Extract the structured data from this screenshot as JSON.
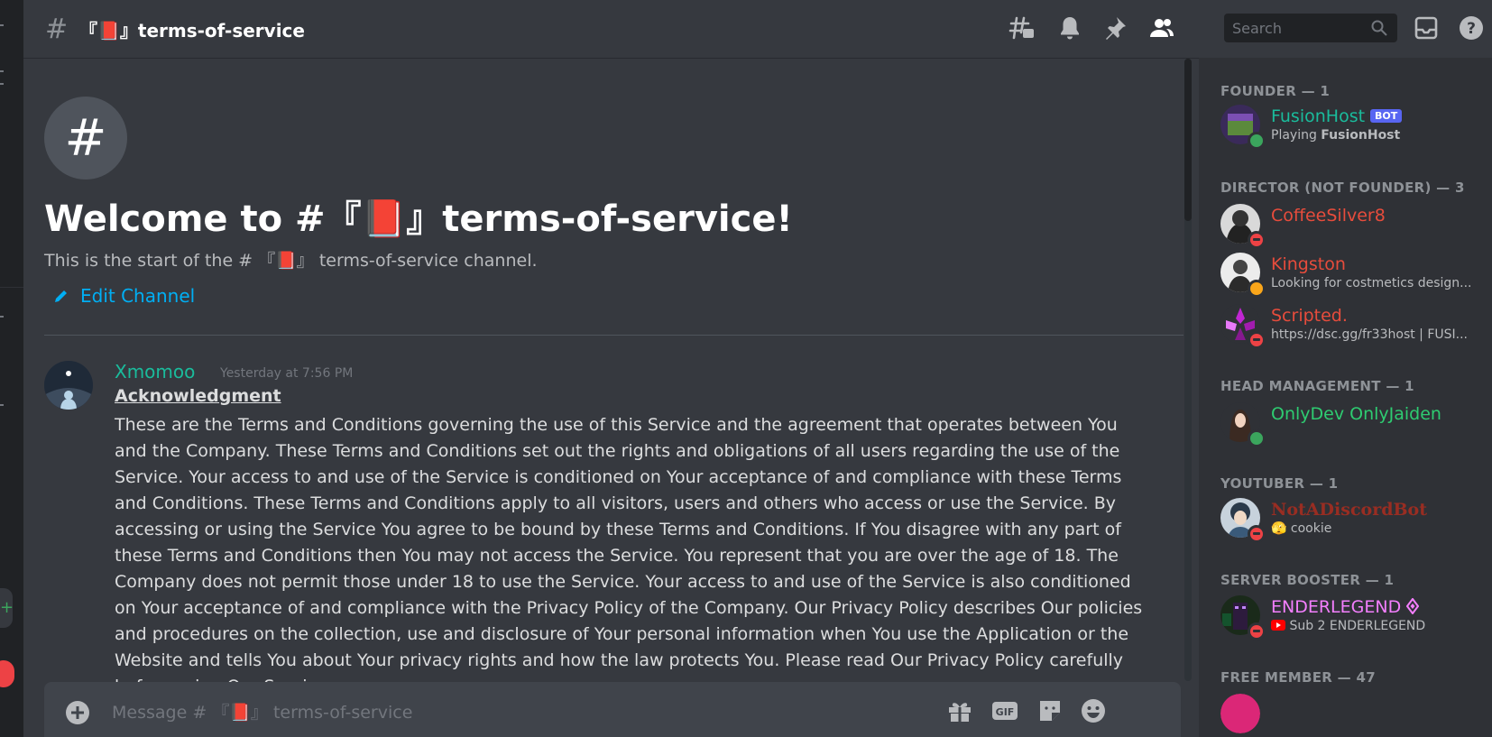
{
  "channel": {
    "hash_symbol": "#",
    "name": "『📕』terms-of-service"
  },
  "toolbar": {
    "search_placeholder": "Search",
    "icons": [
      "threads-icon",
      "bell-icon",
      "pin-icon",
      "members-icon",
      "inbox-icon",
      "help-icon"
    ]
  },
  "welcome": {
    "hash": "#",
    "title": "Welcome to #『📕』terms-of-service!",
    "subtitle": "This is the start of the # 『📕』 terms-of-service channel.",
    "edit_label": "Edit Channel"
  },
  "message": {
    "author": "Xmomoo",
    "timestamp": "Yesterday at 7:56 PM",
    "heading": "Acknowledgment",
    "body": "These are the Terms and Conditions governing the use of this Service and the agreement that operates between You and the Company. These Terms and Conditions set out the rights and obligations of all users regarding the use of the Service. Your access to and use of the Service is conditioned on Your acceptance of and compliance with these Terms and Conditions. These Terms and Conditions apply to all visitors, users and others who access or use the Service. By accessing or using the Service You agree to be bound by these Terms and Conditions. If You disagree with any part of these Terms and Conditions then You may not access the Service. You represent that you are over the age of 18. The Company does not permit those under 18 to use the Service. Your access to and use of the Service is also conditioned on Your acceptance of and compliance with the Privacy Policy of the Company. Our Privacy Policy describes Our policies and procedures on the collection, use and disclosure of Your personal information when You use the Application or the Website and tells You about Your privacy rights and how the law protects You. Please read Our Privacy Policy carefully before using Our Service."
  },
  "composer": {
    "placeholder": "Message # 『📕』 terms-of-service",
    "gif_label": "GIF"
  },
  "members": {
    "founder": {
      "header": "FOUNDER — 1",
      "items": [
        {
          "name": "FusionHost",
          "bot_tag": "BOT",
          "activity_prefix": "Playing ",
          "activity_bold": "FusionHost",
          "status": "online",
          "color": "#1abc9c"
        }
      ]
    },
    "director": {
      "header": "DIRECTOR (NOT FOUNDER) — 3",
      "items": [
        {
          "name": "CoffeeSilver8",
          "activity": "",
          "status": "dnd",
          "color": "#e74c3c"
        },
        {
          "name": "Kingston",
          "activity": "Looking for costmetics design...",
          "status": "idle",
          "color": "#e74c3c"
        },
        {
          "name": "Scripted.",
          "activity": "https://dsc.gg/fr33host | FUSI...",
          "status": "dnd",
          "color": "#e74c3c"
        }
      ]
    },
    "head_management": {
      "header": "HEAD MANAGEMENT — 1",
      "items": [
        {
          "name": "OnlyDev OnlyJaiden",
          "activity": "",
          "status": "online",
          "color": "#2ecc71"
        }
      ]
    },
    "youtuber": {
      "header": "YOUTUBER — 1",
      "items": [
        {
          "name": "NotADiscordBot",
          "activity": "cookie",
          "activity_emoji": "🫣",
          "status": "dnd",
          "color": "#992d22"
        }
      ]
    },
    "server_booster": {
      "header": "SERVER BOOSTER — 1",
      "items": [
        {
          "name": "ENDERLEGEND",
          "activity": "Sub 2 ENDERLEGEND",
          "status": "dnd",
          "color": "#f47fff"
        }
      ]
    },
    "free_member": {
      "header": "FREE MEMBER — 47"
    }
  }
}
